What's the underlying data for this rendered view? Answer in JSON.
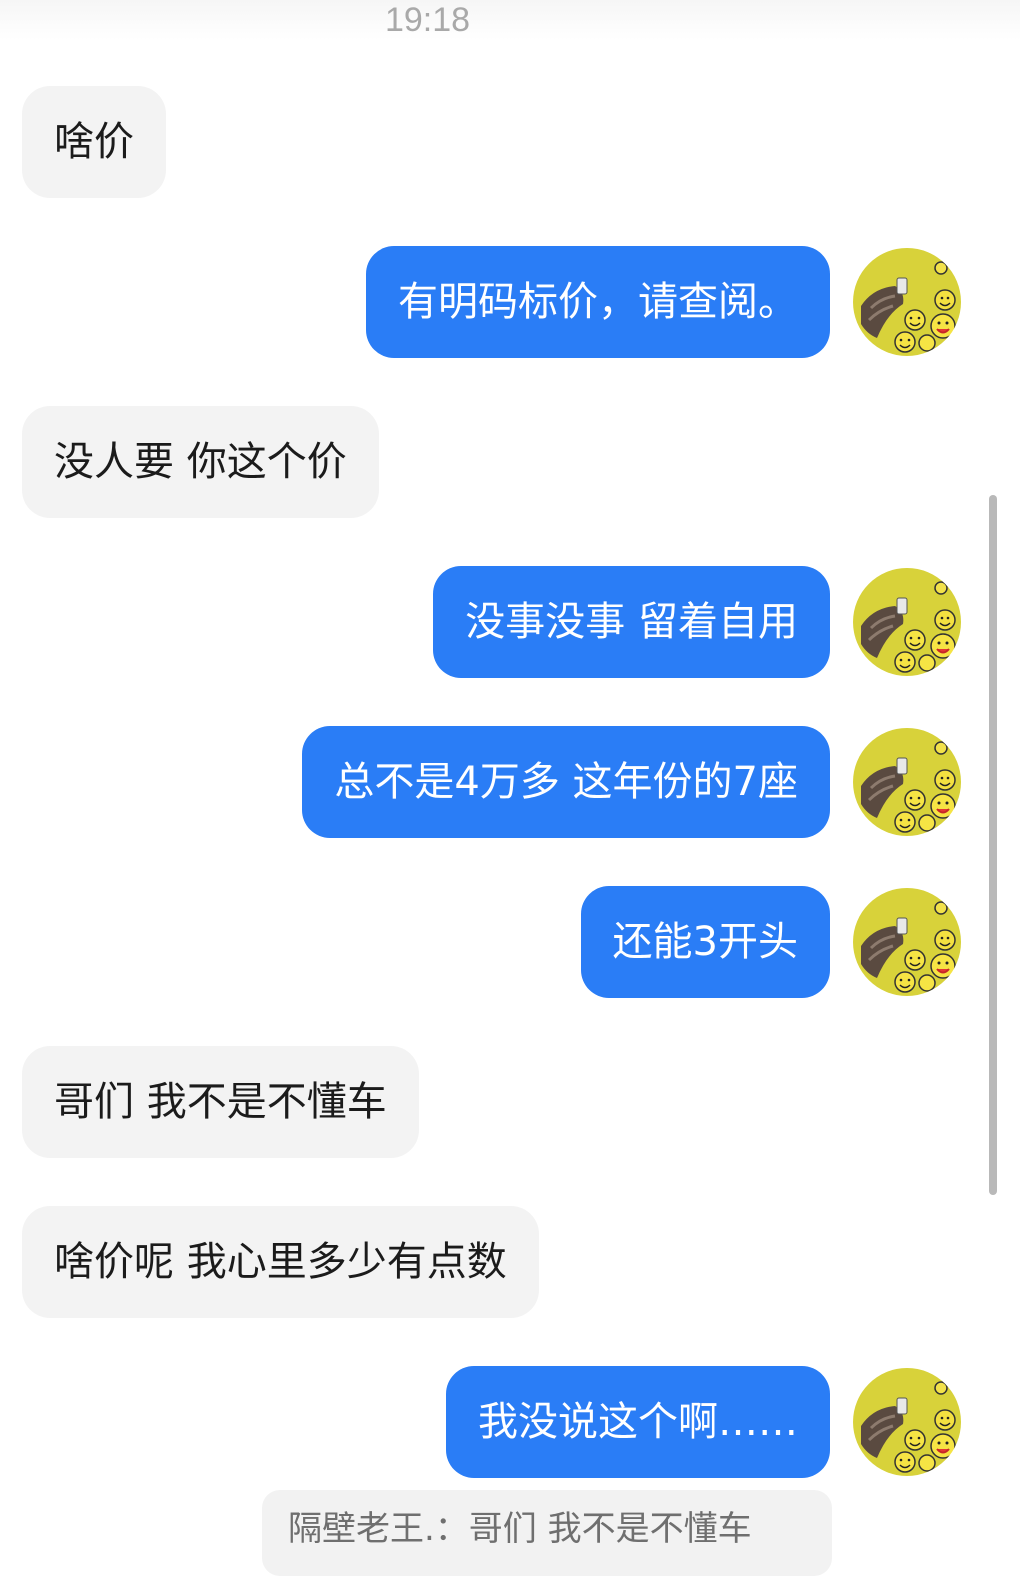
{
  "status_bar": {
    "time": "19:18"
  },
  "messages": [
    {
      "direction": "incoming",
      "text": "啥价"
    },
    {
      "direction": "outgoing",
      "text": "有明码标价，请查阅。"
    },
    {
      "direction": "incoming",
      "text": "没人要 你这个价"
    },
    {
      "direction": "outgoing",
      "text": "没事没事 留着自用"
    },
    {
      "direction": "outgoing",
      "text": "总不是4万多 这年份的7座"
    },
    {
      "direction": "outgoing",
      "text": "还能3开头"
    },
    {
      "direction": "incoming",
      "text": "哥们 我不是不懂车"
    },
    {
      "direction": "incoming",
      "text": "啥价呢 我心里多少有点数"
    },
    {
      "direction": "outgoing",
      "text": "我没说这个啊……"
    }
  ],
  "quote": {
    "text": "隔壁老王.：哥们 我不是不懂车"
  },
  "colors": {
    "outgoing_bubble": "#2a7df6",
    "incoming_bubble": "#f3f3f3",
    "avatar_background": "#d8d23a"
  },
  "avatar": {
    "icon": "smiley-faces-avatar"
  }
}
